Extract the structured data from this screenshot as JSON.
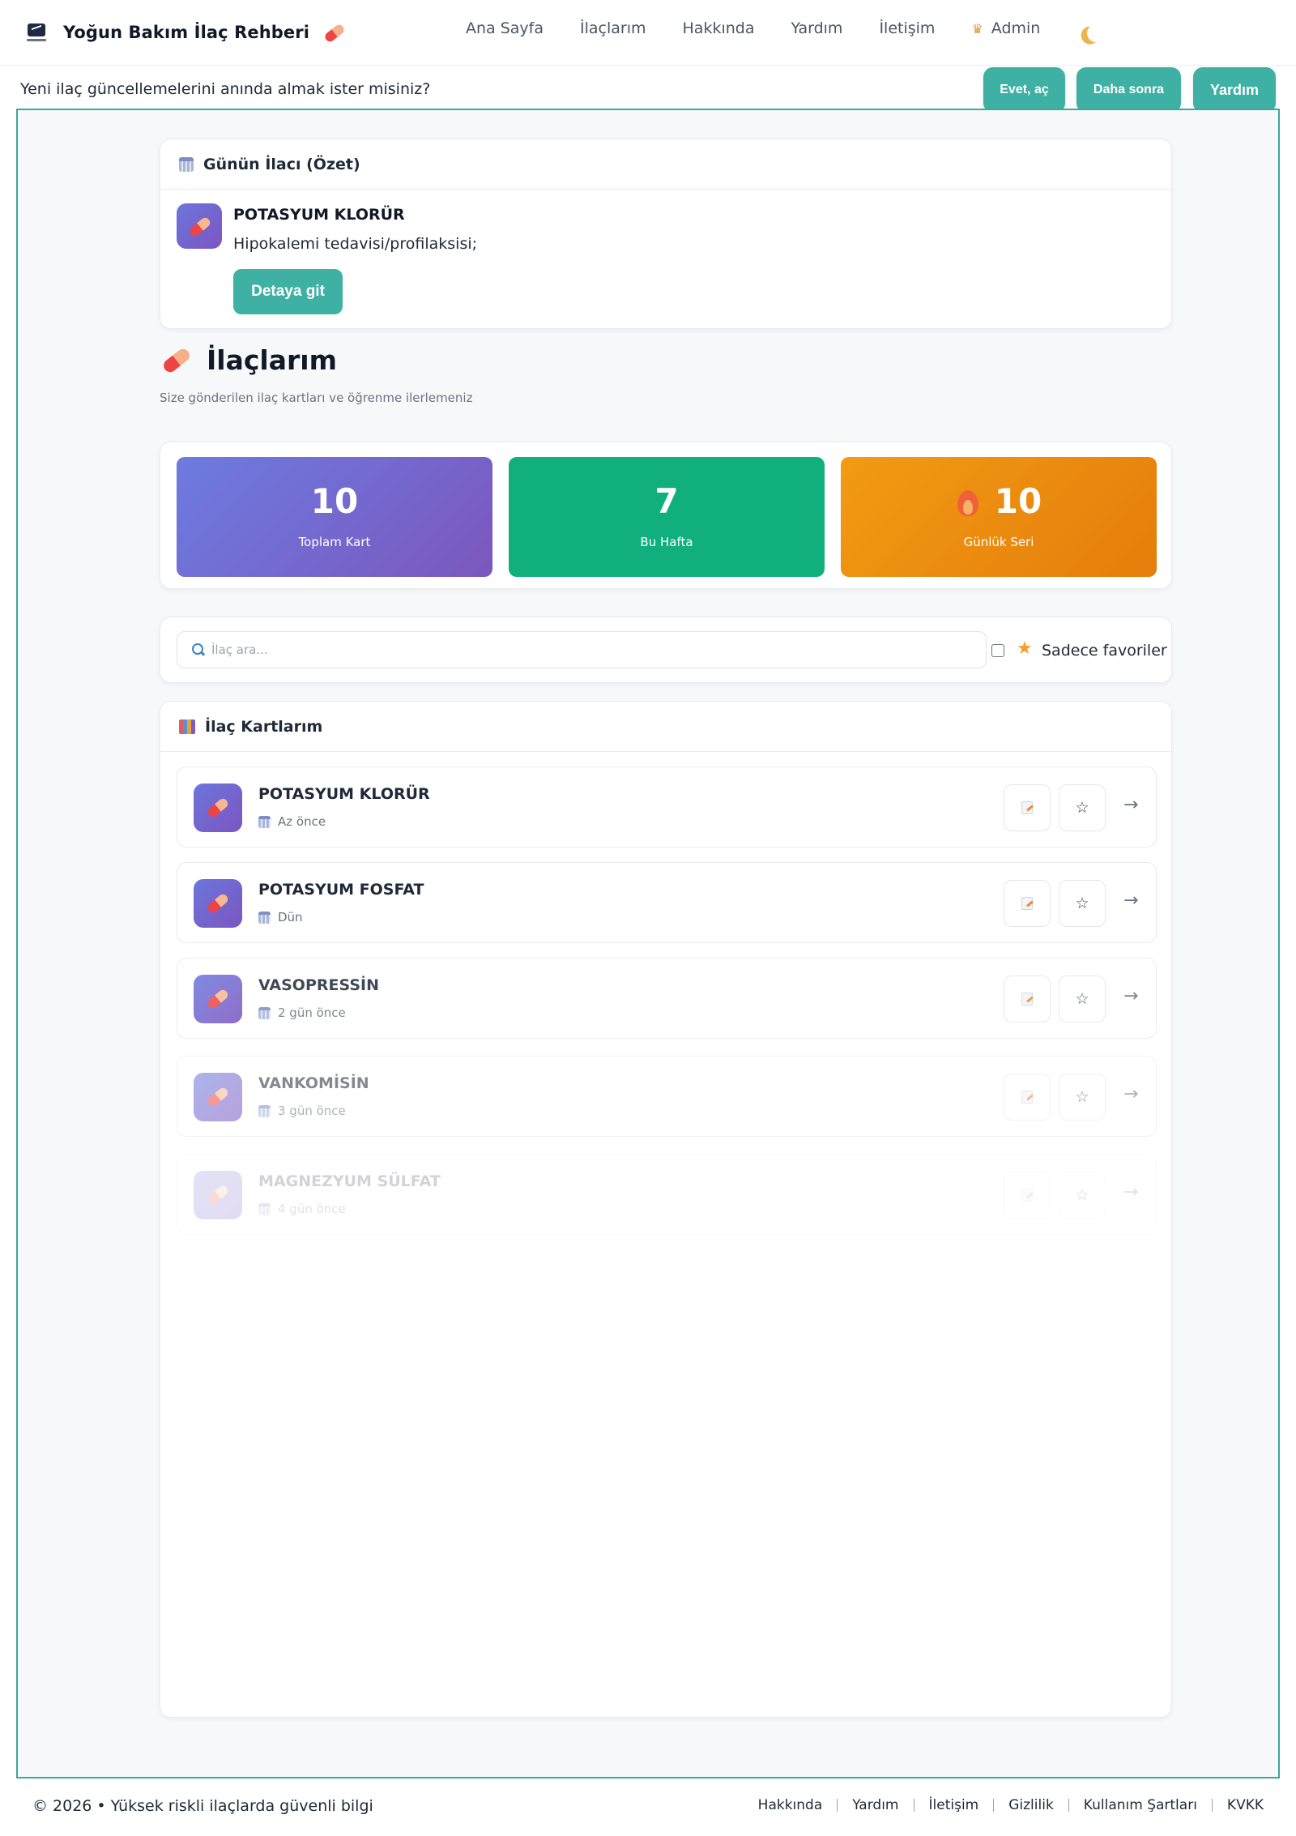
{
  "brand": {
    "title": "Yoğun Bakım İlaç Rehberi"
  },
  "nav": {
    "items": [
      "Ana Sayfa",
      "İlaçlarım",
      "Hakkında",
      "Yardım",
      "İletişim"
    ],
    "admin": "Admin"
  },
  "notify": {
    "text": "Yeni ilaç güncellemelerini anında almak ister misiniz?",
    "yes": "Evet, aç",
    "later": "Daha sonra",
    "help": "Yardım"
  },
  "daily": {
    "header": "Günün İlacı (Özet)",
    "name": "POTASYUM KLORÜR",
    "desc": "Hipokalemi tedavisi/profilaksisi;",
    "button": "Detaya git"
  },
  "page": {
    "title": "İlaçlarım",
    "subtitle": "Size gönderilen ilaç kartları ve öğrenme ilerlemeniz"
  },
  "stats": {
    "total_value": "10",
    "total_label": "Toplam Kart",
    "week_value": "7",
    "week_label": "Bu Hafta",
    "streak_value": "10",
    "streak_label": "Günlük Seri"
  },
  "search": {
    "placeholder": "İlaç ara...",
    "fav_label": "Sadece favoriler"
  },
  "list": {
    "header": "İlaç Kartlarım",
    "items": [
      {
        "name": "POTASYUM KLORÜR",
        "date": "Az önce",
        "opacity": 1
      },
      {
        "name": "POTASYUM FOSFAT",
        "date": "Dün",
        "opacity": 1
      },
      {
        "name": "VASOPRESSİN",
        "date": "2 gün önce",
        "opacity": 0.85
      },
      {
        "name": "VANKOMİSİN",
        "date": "3 gün önce",
        "opacity": 0.55
      },
      {
        "name": "MAGNEZYUM SÜLFAT",
        "date": "4 gün önce",
        "opacity": 0.2
      }
    ]
  },
  "footer": {
    "copy": "© 2026 • Yüksek riskli ilaçlarda güvenli bilgi",
    "links": [
      "Hakkında",
      "Yardım",
      "İletişim",
      "Gizlilik",
      "Kullanım Şartları",
      "KVKK"
    ]
  },
  "colors": {
    "accent": "#3fb1a4",
    "purple": "#7b57be",
    "green": "#11af7e",
    "orange": "#f29b12"
  }
}
